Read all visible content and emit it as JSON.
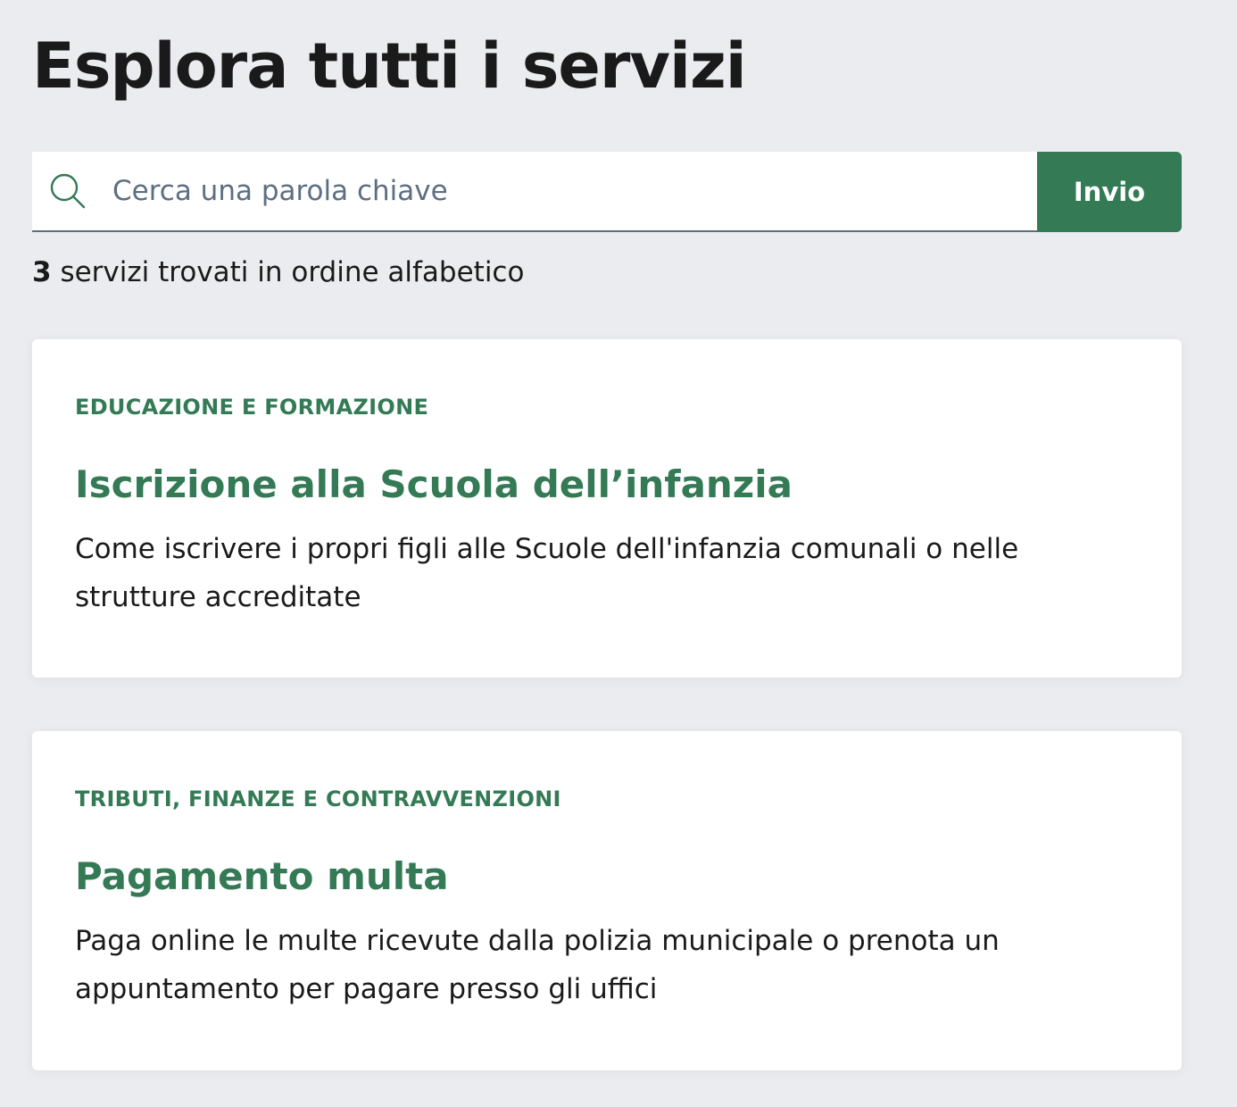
{
  "page": {
    "title": "Esplora tutti i servizi"
  },
  "search": {
    "placeholder": "Cerca una parola chiave",
    "value": "",
    "button_label": "Invio",
    "icon": "search-icon"
  },
  "results": {
    "count": "3",
    "label": "servizi trovati in ordine alfabetico"
  },
  "services": [
    {
      "category": "EDUCAZIONE E FORMAZIONE",
      "title": "Iscrizione alla Scuola dell’infanzia",
      "description": "Come iscrivere i propri figli alle Scuole dell'infanzia comunali o nelle strutture accreditate"
    },
    {
      "category": "TRIBUTI, FINANZE E CONTRAVVENZIONI",
      "title": "Pagamento multa",
      "description": "Paga online le multe ricevute dalla polizia municipale o prenota un appuntamento per pagare presso gli uffici"
    }
  ],
  "colors": {
    "background": "#ebecef",
    "accent": "#337a55",
    "text": "#1a1a1a",
    "muted": "#5c6f82"
  }
}
